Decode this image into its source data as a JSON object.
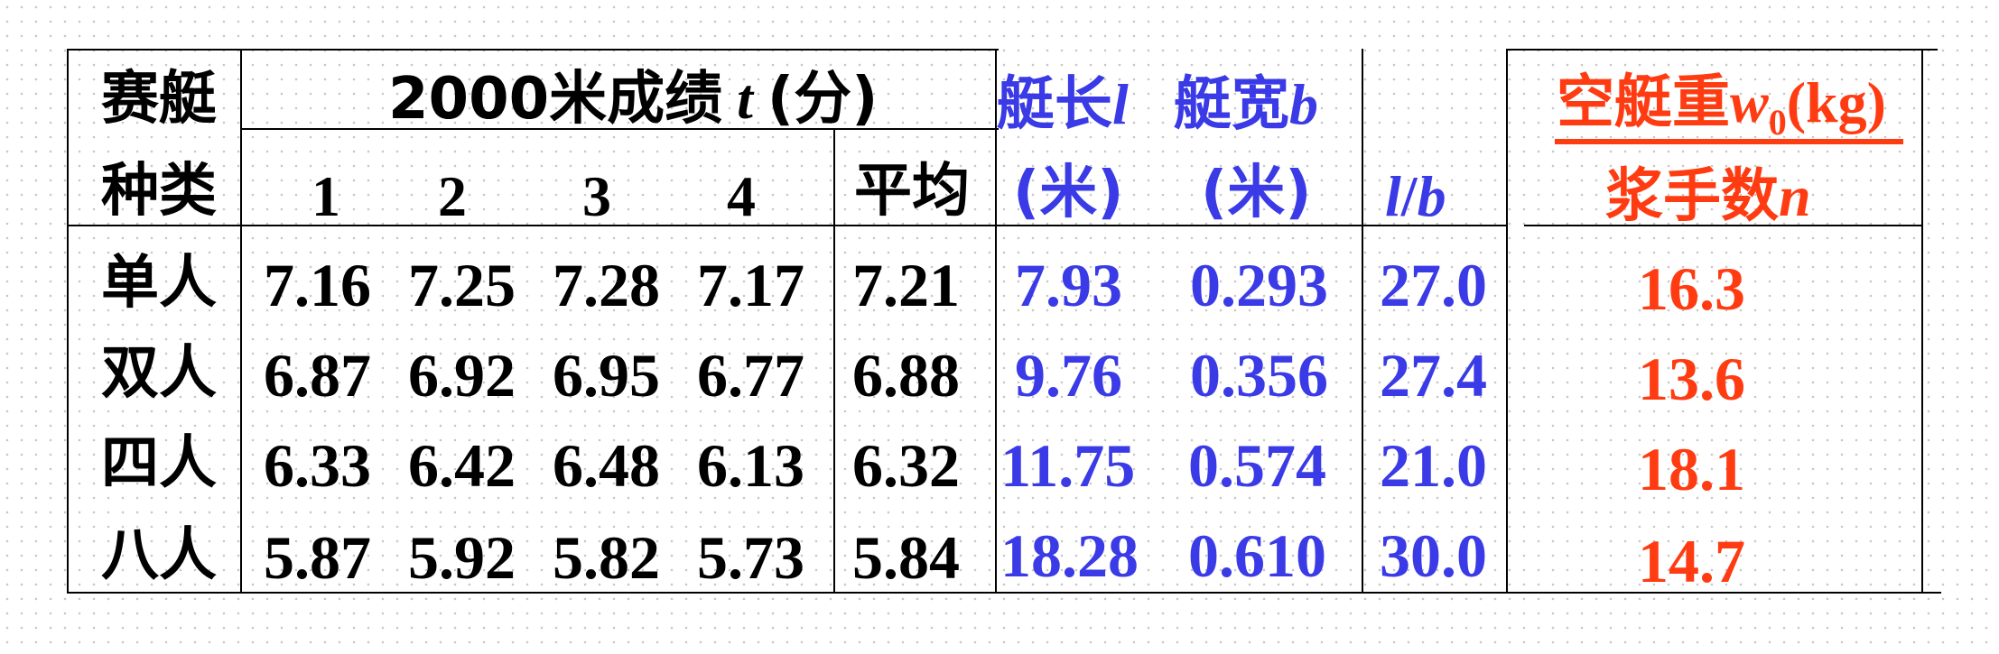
{
  "header": {
    "col1_line1": "赛艇",
    "col1_line2": "种类",
    "time_title_cjk": "2000米成绩",
    "time_title_var": "t",
    "time_title_unit": "(分)",
    "time_cols": [
      "1",
      "2",
      "3",
      "4"
    ],
    "average": "平均",
    "length_cjk": "艇长",
    "length_var": "l",
    "width_cjk": "艇宽",
    "width_var": "b",
    "unit_m": "(米)",
    "ratio_l": "l",
    "ratio_slash": "/",
    "ratio_b": "b",
    "weight_cjk": "空艇重",
    "weight_var": "w",
    "weight_sub": "0",
    "weight_unit": "(kg)",
    "rowers_cjk": "浆手数",
    "rowers_var": "n"
  },
  "rows": [
    {
      "type": "单人",
      "t": [
        "7.16",
        "7.25",
        "7.28",
        "7.17"
      ],
      "avg": "7.21",
      "l": "7.93",
      "b": "0.293",
      "lb": "27.0",
      "wn": "16.3"
    },
    {
      "type": "双人",
      "t": [
        "6.87",
        "6.92",
        "6.95",
        "6.77"
      ],
      "avg": "6.88",
      "l": "9.76",
      "b": "0.356",
      "lb": "27.4",
      "wn": "13.6"
    },
    {
      "type": "四人",
      "t": [
        "6.33",
        "6.42",
        "6.48",
        "6.13"
      ],
      "avg": "6.32",
      "l": "11.75",
      "b": "0.574",
      "lb": "21.0",
      "wn": "18.1"
    },
    {
      "type": "八人",
      "t": [
        "5.87",
        "5.92",
        "5.82",
        "5.73"
      ],
      "avg": "5.84",
      "l": "18.28",
      "b": "0.610",
      "lb": "30.0",
      "wn": "14.7"
    }
  ],
  "colors": {
    "text": "#000000",
    "blue": "#3a3ae6",
    "red": "#ff3b12"
  }
}
